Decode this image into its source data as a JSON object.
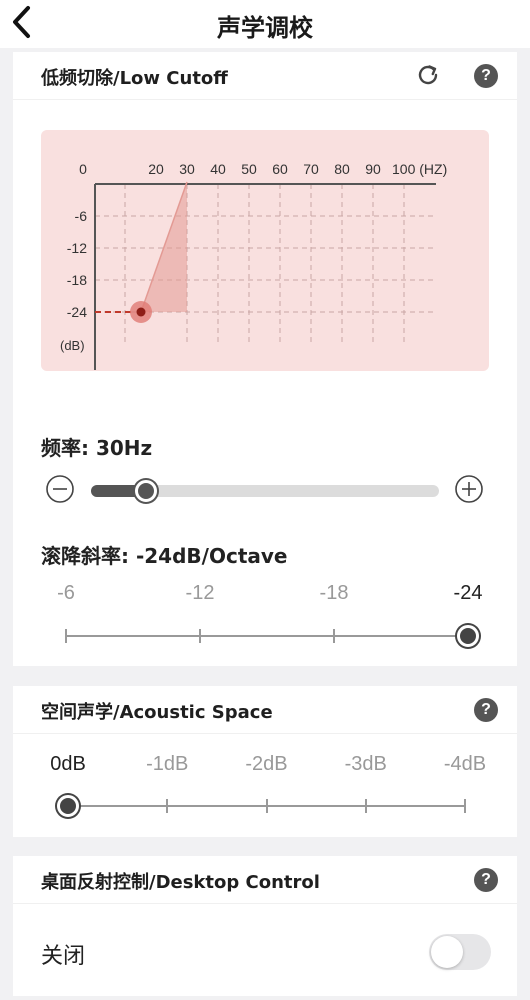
{
  "header": {
    "title": "声学调校"
  },
  "low_cutoff": {
    "title": "低频切除/Low Cutoff",
    "chart": {
      "x_ticks": [
        "0",
        "20",
        "30",
        "40",
        "50",
        "60",
        "70",
        "80",
        "90",
        "100 (HZ)"
      ],
      "y_ticks": [
        "-6",
        "-12",
        "-18",
        "-24"
      ],
      "y_unit": "(dB)",
      "accent_color": "#c0392b",
      "background_color": "#f9e0df"
    },
    "frequency_label": "频率: 30Hz",
    "frequency_fraction": 0.15,
    "rolloff_label": "滚降斜率: -24dB/Octave",
    "rolloff_options": [
      "-6",
      "-12",
      "-18",
      "-24"
    ],
    "rolloff_selected_index": 3
  },
  "acoustic_space": {
    "title": "空间声学/Acoustic Space",
    "options": [
      "0dB",
      "-1dB",
      "-2dB",
      "-3dB",
      "-4dB"
    ],
    "selected_index": 0
  },
  "desktop_control": {
    "title": "桌面反射控制/Desktop Control",
    "state_label": "关闭",
    "enabled": false
  }
}
